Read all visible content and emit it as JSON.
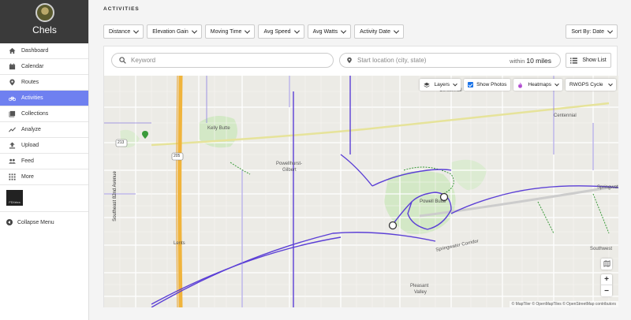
{
  "user": {
    "name": "Chels"
  },
  "nav": {
    "items": [
      {
        "label": "Dashboard",
        "icon": "home-icon"
      },
      {
        "label": "Calendar",
        "icon": "calendar-icon"
      },
      {
        "label": "Routes",
        "icon": "pin-icon"
      },
      {
        "label": "Activities",
        "icon": "bike-icon",
        "active": true
      },
      {
        "label": "Collections",
        "icon": "collections-icon"
      },
      {
        "label": "Analyze",
        "icon": "analyze-icon"
      },
      {
        "label": "Upload",
        "icon": "upload-icon"
      },
      {
        "label": "Feed",
        "icon": "feed-icon"
      },
      {
        "label": "More",
        "icon": "grid-icon"
      }
    ],
    "club_logo_text": "PDXebra",
    "collapse_label": "Collapse Menu"
  },
  "page": {
    "title": "ACTIVITIES"
  },
  "filters": [
    "Distance",
    "Elevation Gain",
    "Moving Time",
    "Avg Speed",
    "Avg Watts",
    "Activity Date"
  ],
  "sort": {
    "label": "Sort By: Date"
  },
  "search": {
    "keyword_placeholder": "Keyword",
    "location_placeholder": "Start location (city, state)",
    "within_prefix": "within",
    "within_value": "10 miles"
  },
  "show_list_label": "Show List",
  "map": {
    "layers_label": "Layers",
    "show_photos_label": "Show Photos",
    "heatmaps_label": "Heatmaps",
    "basemap_label": "RWGPS Cycle",
    "zoom_in": "+",
    "zoom_out": "−",
    "attribution": "© MapTiler © OpenMapTiles © OpenStreetMap contributors",
    "labels": {
      "kelly_butte": "Kelly Butte",
      "powellhurst": "Powellhurst-",
      "gilbert": "Gilbert",
      "powell_butte": "Powell Butte",
      "lents": "Lents",
      "pleasant": "Pleasant",
      "valley": "Valley",
      "centennial_top": "Centennial",
      "centennial": "Centennial",
      "springwater": "Springwat",
      "springwater_corridor": "Springwater Corridor",
      "southwest": "Southwest",
      "se_82nd": "Southeast 82nd Avenue",
      "rt_213": "213",
      "rt_205": "205"
    },
    "colors": {
      "route": "#5b3fd6",
      "trail": "#3a9a3a",
      "freeway": "#f0b43c"
    }
  }
}
